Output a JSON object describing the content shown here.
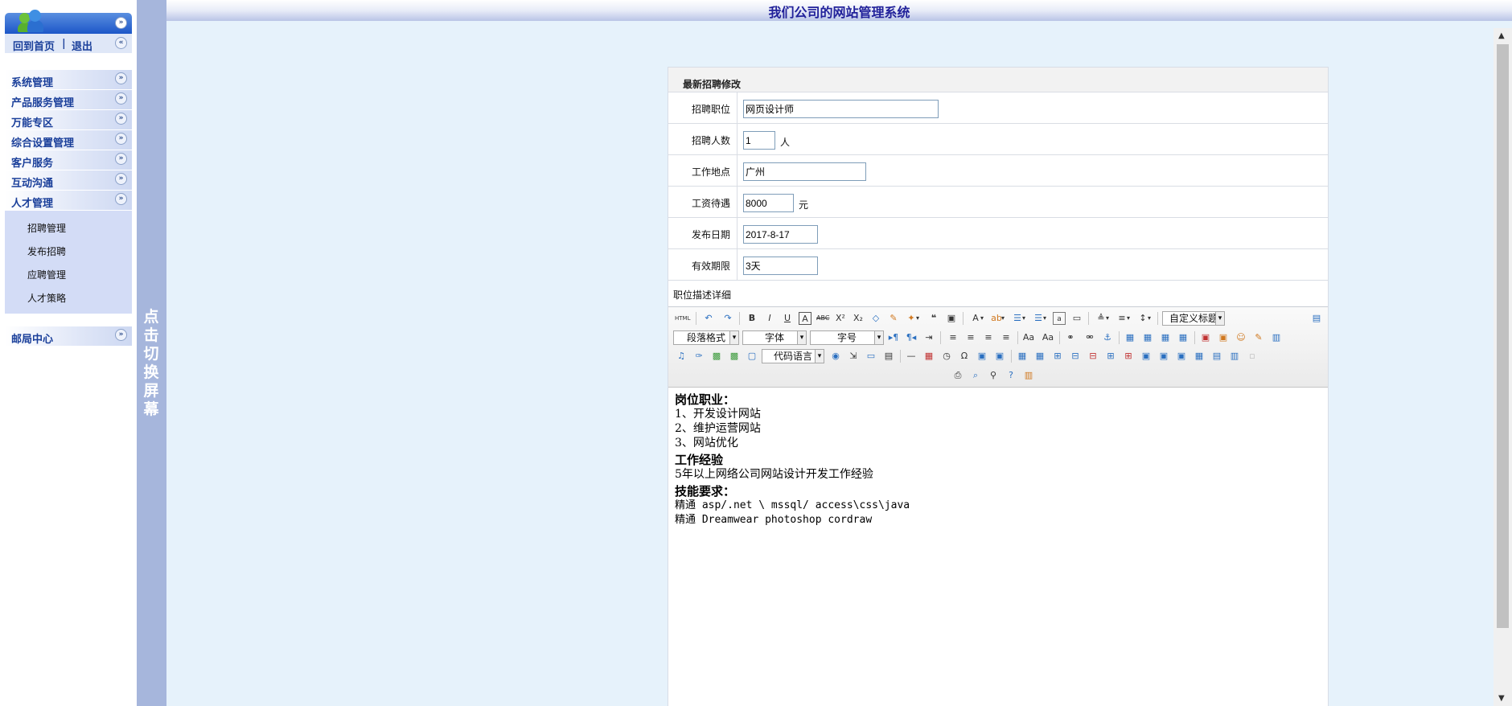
{
  "header": {
    "title": "我们公司的网站管理系统"
  },
  "sidebar": {
    "top_links": {
      "home": "回到首页",
      "divider": "|",
      "logout": "退出"
    },
    "menu": [
      {
        "label": "系统管理"
      },
      {
        "label": "产品服务管理"
      },
      {
        "label": "万能专区"
      },
      {
        "label": "综合设置管理"
      },
      {
        "label": "客户服务"
      },
      {
        "label": "互动沟通"
      },
      {
        "label": "人才管理"
      }
    ],
    "submenu": [
      "招聘管理",
      "发布招聘",
      "应聘管理",
      "人才策略"
    ],
    "mailbox": {
      "label": "邮局中心"
    }
  },
  "toggle_bar": {
    "text": [
      "点",
      "击",
      "切",
      "换",
      "屏",
      "幕"
    ]
  },
  "form": {
    "title": "最新招聘修改",
    "fields": {
      "position": {
        "label": "招聘职位",
        "value": "网页设计师"
      },
      "count": {
        "label": "招聘人数",
        "value": "1",
        "unit": "人"
      },
      "location": {
        "label": "工作地点",
        "value": "广州"
      },
      "salary": {
        "label": "工资待遇",
        "value": "8000",
        "unit": "元"
      },
      "date": {
        "label": "发布日期",
        "value": "2017-8-17"
      },
      "validity": {
        "label": "有效期限",
        "value": "3天"
      }
    },
    "description_label": "职位描述详细"
  },
  "editor": {
    "selects": {
      "custom_title": "自定义标题",
      "paragraph": "段落格式",
      "font": "字体",
      "size": "字号",
      "code_lang": "代码语言"
    },
    "content": {
      "h1": "岗位职业：",
      "l1": "1、开发设计网站",
      "l2": "2、维护运营网站",
      "l3": "3、网站优化",
      "h2": "工作经验",
      "l4": "5年以上网络公司网站设计开发工作经验",
      "h3": "技能要求：",
      "l5": "精通 asp/.net \\ mssql/ access\\css\\java",
      "l6": "精通 Dreamwear photoshop cordraw"
    }
  }
}
